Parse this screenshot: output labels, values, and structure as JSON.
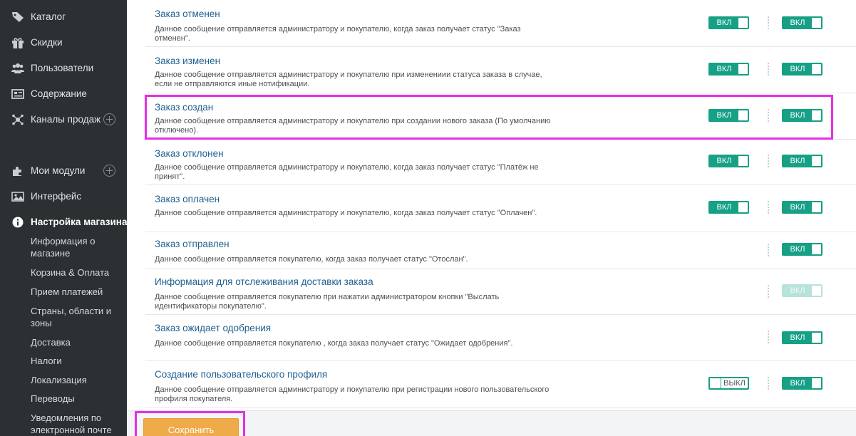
{
  "sidebar": {
    "items": [
      {
        "label": "Каталог",
        "icon": "tag-icon"
      },
      {
        "label": "Скидки",
        "icon": "gift-icon"
      },
      {
        "label": "Пользователи",
        "icon": "users-icon"
      },
      {
        "label": "Содержание",
        "icon": "newspaper-icon"
      },
      {
        "label": "Каналы продаж",
        "icon": "network-icon"
      },
      {
        "label": "Мои модули",
        "icon": "puzzle-icon"
      },
      {
        "label": "Интерфейс",
        "icon": "image-icon"
      },
      {
        "label": "Настройка магазина",
        "icon": "info-icon"
      }
    ],
    "sub_items": [
      {
        "label": "Информация о магазине"
      },
      {
        "label": "Корзина & Оплата"
      },
      {
        "label": "Прием платежей"
      },
      {
        "label": "Страны, области и зоны"
      },
      {
        "label": "Доставка"
      },
      {
        "label": "Налоги"
      },
      {
        "label": "Локализация"
      },
      {
        "label": "Переводы"
      },
      {
        "label": "Уведомления по электронной почте"
      }
    ]
  },
  "notifications": [
    {
      "title": "Заказ отменен",
      "desc": "Данное сообщение отправляется администратору и покупателю, когда заказ получает статус \"Заказ отменен\".",
      "admin": "ВКЛ",
      "customer": "ВКЛ"
    },
    {
      "title": "Заказ изменен",
      "desc": "Данное сообщение отправляется администратору и покупателю при изменениии статуса заказа в случае, если не отправляются иные нотификации.",
      "admin": "ВКЛ",
      "customer": "ВКЛ"
    },
    {
      "title": "Заказ создан",
      "desc": "Данное сообщение отправляется администратору и покупателю при создании нового заказа (По умолчанию отключено).",
      "admin": "ВКЛ",
      "customer": "ВКЛ"
    },
    {
      "title": "Заказ отклонен",
      "desc": "Данное сообщение отправляется администратору и покупателю, когда заказ получает статус \"Платёж не принят\".",
      "admin": "ВКЛ",
      "customer": "ВКЛ"
    },
    {
      "title": "Заказ оплачен",
      "desc": "Данное сообщение отправляется администратору и покупателю, когда заказ получает статус \"Оплачен\".",
      "admin": "ВКЛ",
      "customer": "ВКЛ"
    },
    {
      "title": "Заказ отправлен",
      "desc": "Данное сообщение отправляется покупателю, когда заказ получает статус \"Отослан\".",
      "admin": "",
      "customer": "ВКЛ"
    },
    {
      "title": "Информация для отслеживания доставки заказа",
      "desc": "Данное сообщение отправляется покупателю при нажатии администратором кнопки \"Выслать идентификаторы покупателю\".",
      "admin": "",
      "customer": "ВКЛ"
    },
    {
      "title": "Заказ ожидает одобрения",
      "desc": "Данное сообщение отправляется покупателю , когда заказ получает статус \"Ожидает одобрения\".",
      "admin": "",
      "customer": "ВКЛ"
    },
    {
      "title": "Создание пользовательского профиля",
      "desc": "Данное сообщение отправляется администратору и покупателю при регистрации нового пользовательского профиля покупателя.",
      "admin": "ВЫКЛ",
      "customer": "ВКЛ"
    }
  ],
  "footer": {
    "save_label": "Сохранить"
  },
  "colors": {
    "accent": "#16a085",
    "sidebar_bg": "#2b3033",
    "link": "#1f5f8e",
    "save_button": "#efaa4a",
    "highlight": "#e62ee6"
  }
}
